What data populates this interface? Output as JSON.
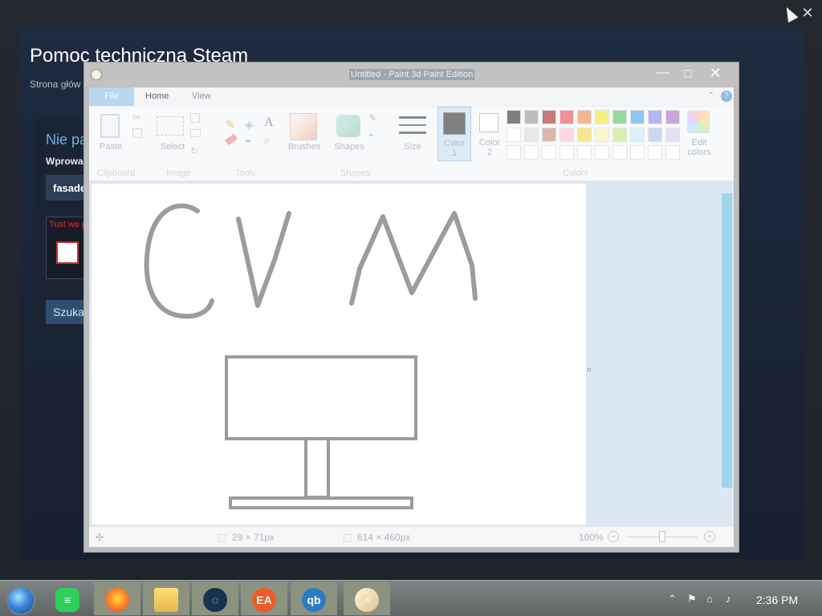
{
  "steam": {
    "title": "Pomoc techniczna Steam",
    "breadcrumb": "Strona głów",
    "card_title": "Nie pa",
    "card_sub": "Wprowa",
    "input_value": "fasade",
    "captcha_text": "Tust we\npiniowr",
    "button_label": "Szuka"
  },
  "paint": {
    "title_text": "Untitled - Paint 3d Paint Edition",
    "tabs": [
      "File",
      "Home",
      "View"
    ],
    "ribbon_labels": {
      "paste": "Paste",
      "select": "Select",
      "brushes": "Brushes",
      "shapes": "Shapes",
      "size": "Size",
      "color1": "Color\n1",
      "color2": "Color\n2",
      "edit_colors": "Edit\ncolors"
    },
    "groups": [
      "Clipboard",
      "Image",
      "Tools",
      "Shapes",
      "Colors"
    ],
    "status": {
      "selection_size": "29 × 71px",
      "canvas_size": "614 × 460px",
      "zoom": "100%"
    }
  },
  "palette": {
    "row1": [
      "#7f7f7f",
      "#bdbdbd",
      "#c77a7a",
      "#f08f98",
      "#f3b78e",
      "#f6ef83",
      "#98d8a2",
      "#8cc8eb",
      "#b8b5ee",
      "#c7a6d9"
    ],
    "row2": [
      "#ffffff",
      "#e8e8e8",
      "#d9b8a8",
      "#ffd6e0",
      "#f8e68a",
      "#fbf8cf",
      "#d8f0ad",
      "#d8f2fb",
      "#ccd6f0",
      "#e6dff5"
    ],
    "row3": [
      "#ffffff",
      "#ffffff",
      "#ffffff",
      "#ffffff",
      "#ffffff",
      "#ffffff",
      "#ffffff",
      "#ffffff",
      "#ffffff",
      "#ffffff"
    ]
  },
  "drawing": {
    "stroke": "#9c9c9c"
  },
  "taskbar": {
    "apps": [
      "Start",
      "Notes",
      "Firefox",
      "File Explorer",
      "Steam",
      "EA",
      "qBittorrent",
      "Paint"
    ],
    "clock": "2:36 PM",
    "tray_icons": [
      "up-arrow",
      "flag",
      "network",
      "volume"
    ]
  }
}
